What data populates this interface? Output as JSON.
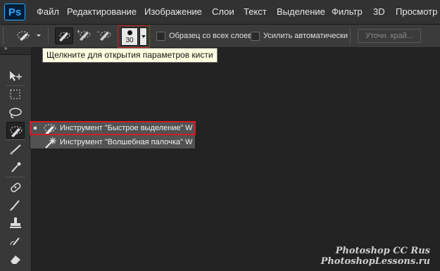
{
  "app": {
    "logo": "Ps"
  },
  "menu": {
    "items": [
      "Файл",
      "Редактирование",
      "Изображение",
      "Слои",
      "Текст",
      "Выделение",
      "Фильтр",
      "3D",
      "Просмотр"
    ]
  },
  "options": {
    "brush_size": "30",
    "sample_all_layers_label": "Образец со всех слоев",
    "sample_all_layers_checked": false,
    "auto_enhance_label": "Усилить автоматически",
    "auto_enhance_checked": false,
    "refine_edge_label": "Уточн. край..."
  },
  "tooltip": {
    "text": "Щелкните для открытия параметров кисти"
  },
  "toolbox": {
    "collapse_glyph": "»",
    "tools": [
      "move-tool",
      "marquee-tool",
      "lasso-tool",
      "quick-selection-tool",
      "crop-tool",
      "eyedropper-tool",
      "healing-brush-tool",
      "brush-tool",
      "clone-stamp-tool",
      "history-brush-tool",
      "eraser-tool"
    ]
  },
  "flyout": {
    "items": [
      {
        "label": "Инструмент \"Быстрое выделение\"",
        "shortcut": "W",
        "selected": true
      },
      {
        "label": "Инструмент \"Волшебная палочка\"",
        "shortcut": "W",
        "selected": false
      }
    ]
  },
  "watermark": {
    "line1": "Photoshop CC Rus",
    "line2": "PhotoshopLessons.ru"
  },
  "colors": {
    "highlight": "#cc2020",
    "tooltip_bg": "#ffffe1",
    "logo_blue": "#31a8ff"
  }
}
